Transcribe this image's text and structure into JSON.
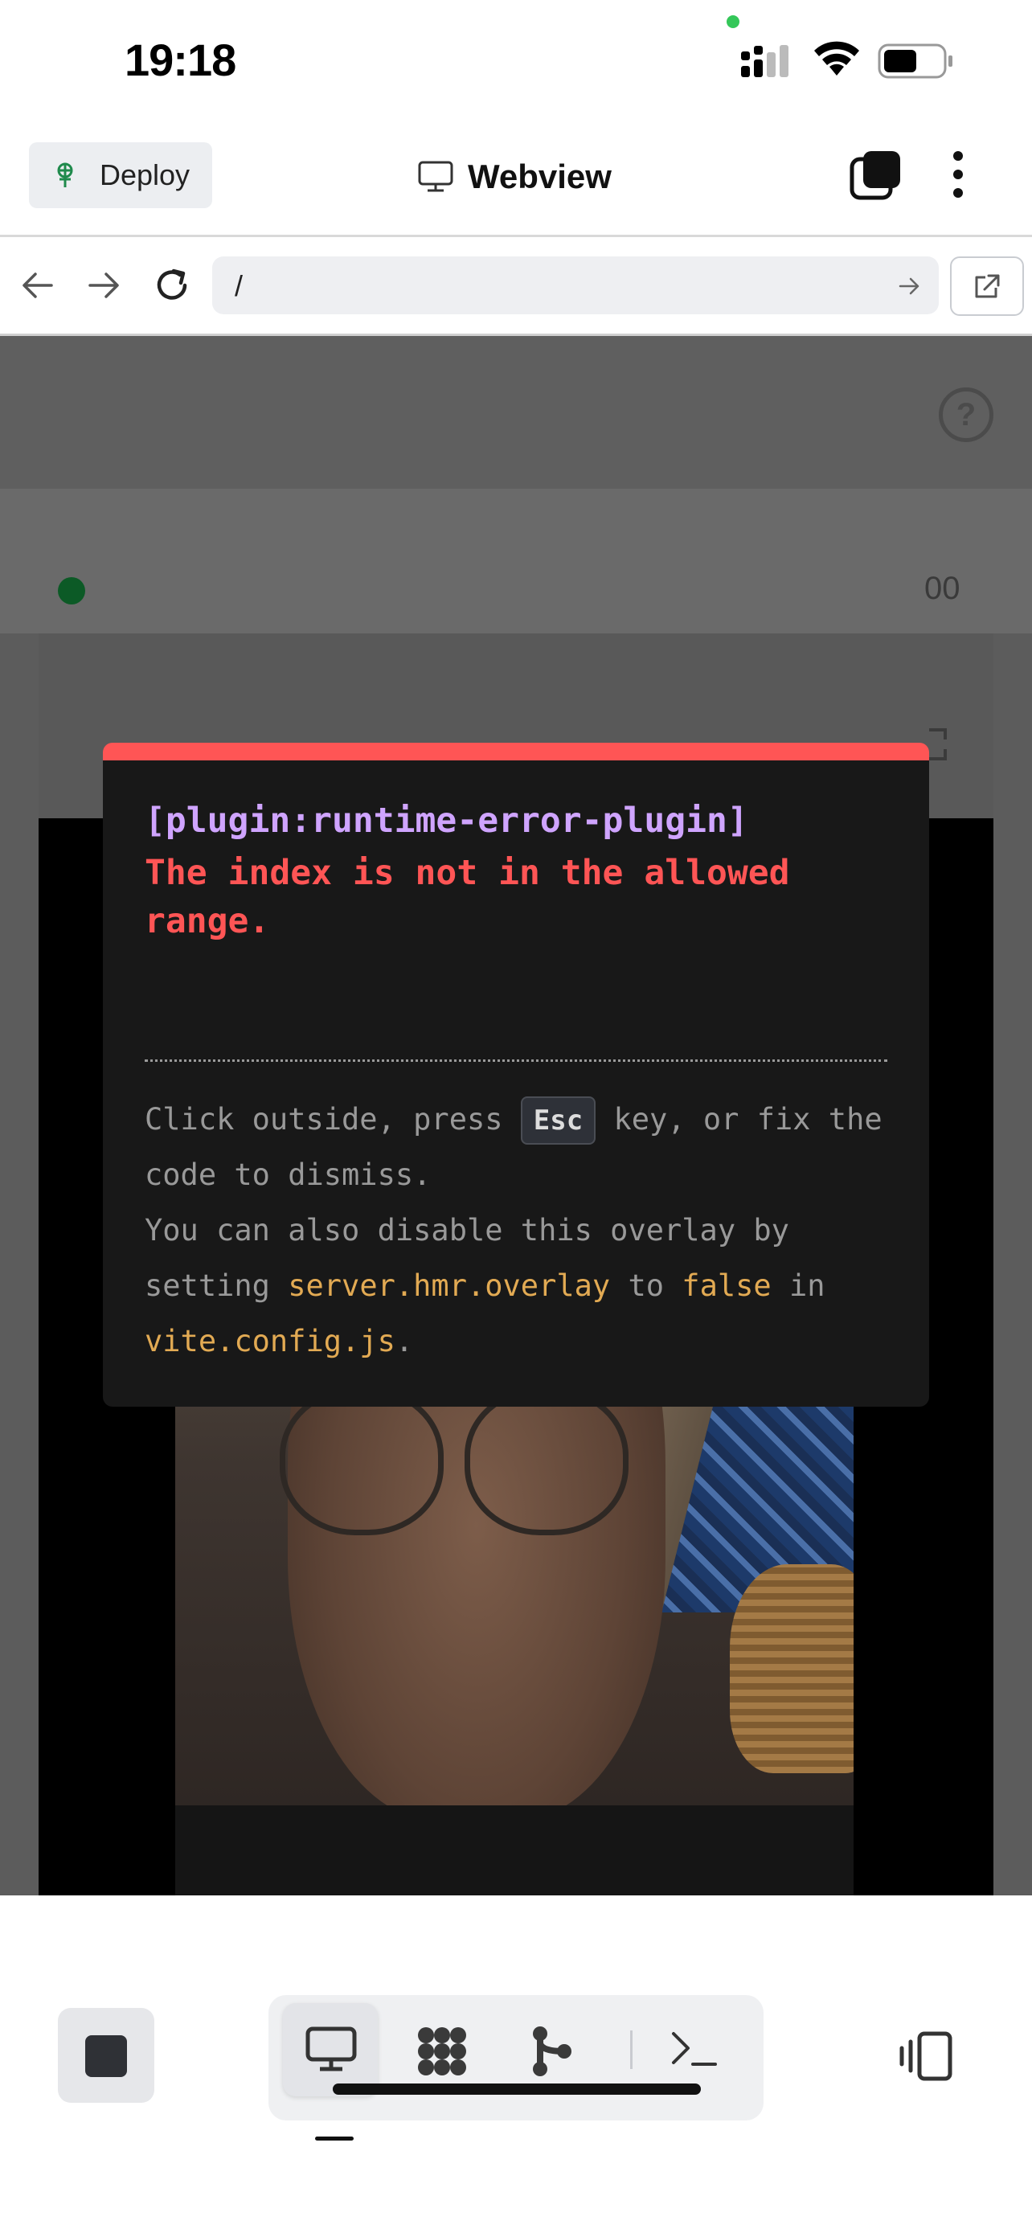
{
  "status_bar": {
    "time": "19:18",
    "icons": [
      "cellular-signal-icon",
      "wifi-icon",
      "battery-icon"
    ],
    "privacy_indicator_color": "#34c759"
  },
  "header": {
    "deploy_label": "Deploy",
    "title": "Webview",
    "icons": [
      "deploy-icon",
      "monitor-icon",
      "tabs-icon",
      "kebab-menu-icon"
    ]
  },
  "url_bar": {
    "url": "/",
    "icons": [
      "back-arrow-icon",
      "forward-arrow-icon",
      "reload-icon",
      "go-arrow-icon",
      "open-external-icon"
    ]
  },
  "background_page": {
    "time_fragment": "00",
    "help_icon": "?"
  },
  "error_overlay": {
    "plugin": "[plugin:runtime-error-plugin]",
    "message": "The index is not in the allowed range.",
    "tip_prefix": "Click outside, press ",
    "tip_key": "Esc",
    "tip_middle": " key, or fix the code to dismiss.",
    "tip_line2_prefix": "You can also disable this overlay by setting ",
    "tip_code1": "server.hmr.overlay",
    "tip_to": " to ",
    "tip_code2": "false",
    "tip_in": " in ",
    "tip_code3": "vite.config.js",
    "tip_end": ".",
    "accent_color": "#ff5555",
    "plugin_color": "#cfa4ff",
    "code_color": "#e2aa53"
  },
  "bottom_bar": {
    "tools": [
      "webview-tool",
      "workspace-tool",
      "git-tool",
      "shell-tool"
    ],
    "active_tool": "webview-tool",
    "icons": [
      "stop-icon",
      "monitor-icon",
      "grid-icon",
      "git-branch-icon",
      "terminal-icon",
      "panel-toggle-icon"
    ]
  }
}
